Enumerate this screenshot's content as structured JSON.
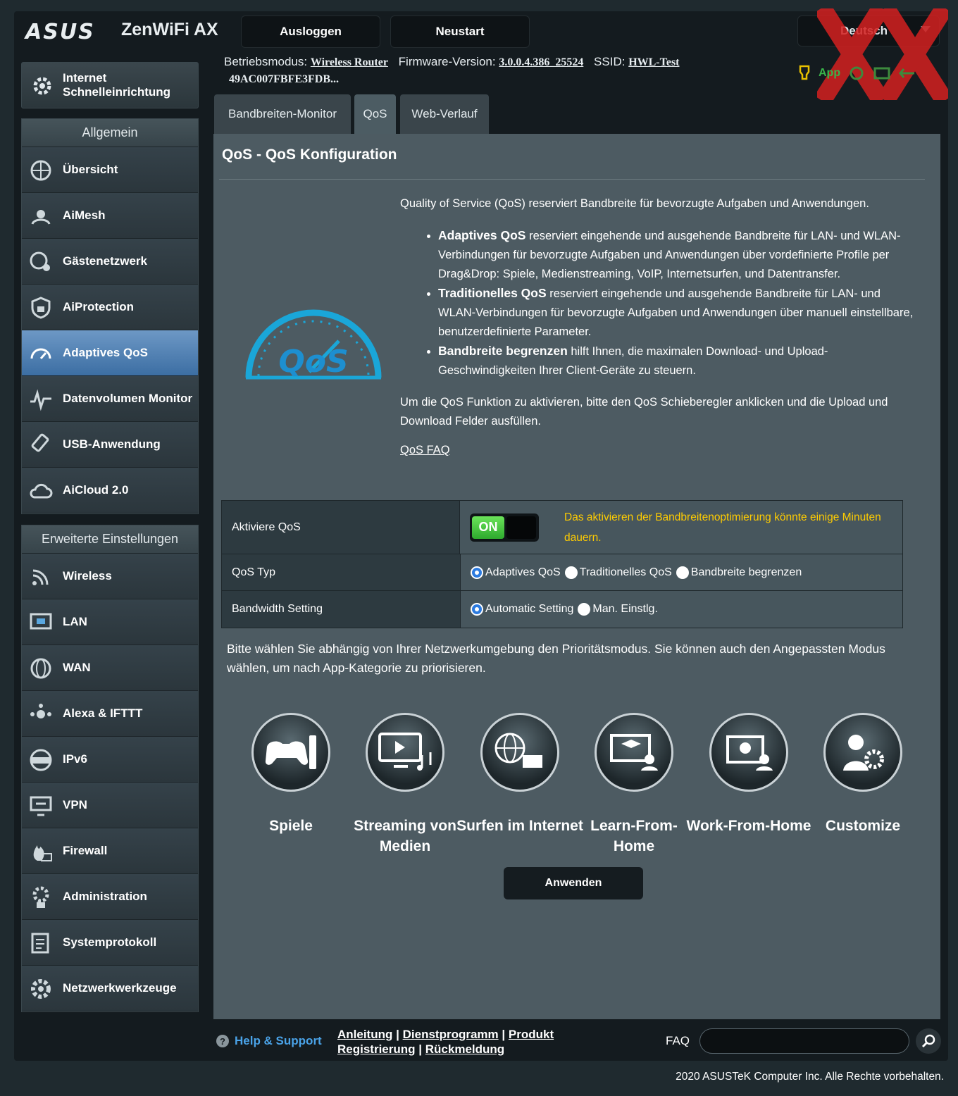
{
  "header": {
    "logo": "ASUS",
    "model": "ZenWiFi AX",
    "logout_label": "Ausloggen",
    "reboot_label": "Neustart",
    "language": "Deutsch"
  },
  "status": {
    "mode_label": "Betriebsmodus:",
    "mode_value": "Wireless Router",
    "fw_label": "Firmware-Version:",
    "fw_value": "3.0.0.4.386_25524",
    "ssid_label": "SSID:",
    "ssid_value": "HWL-Test",
    "ssid_value2": "49AC007FBFE3FDB...",
    "app_label": "App"
  },
  "sidebar": {
    "quick_setup": "Internet Schnelleinrichtung",
    "general_title": "Allgemein",
    "general_items": [
      {
        "label": "Übersicht",
        "icon": "globe-icon"
      },
      {
        "label": "AiMesh",
        "icon": "mesh-icon"
      },
      {
        "label": "Gästenetzwerk",
        "icon": "guest-network-icon"
      },
      {
        "label": "AiProtection",
        "icon": "shield-lock-icon"
      },
      {
        "label": "Adaptives QoS",
        "icon": "speedometer-icon"
      },
      {
        "label": "Datenvolumen Monitor",
        "icon": "traffic-monitor-icon"
      },
      {
        "label": "USB-Anwendung",
        "icon": "usb-icon"
      },
      {
        "label": "AiCloud 2.0",
        "icon": "cloud-icon"
      }
    ],
    "advanced_title": "Erweiterte Einstellungen",
    "advanced_items": [
      {
        "label": "Wireless",
        "icon": "wireless-icon"
      },
      {
        "label": "LAN",
        "icon": "lan-icon"
      },
      {
        "label": "WAN",
        "icon": "wan-globe-icon"
      },
      {
        "label": "Alexa & IFTTT",
        "icon": "alexa-icon"
      },
      {
        "label": "IPv6",
        "icon": "ipv6-icon"
      },
      {
        "label": "VPN",
        "icon": "vpn-icon"
      },
      {
        "label": "Firewall",
        "icon": "firewall-icon"
      },
      {
        "label": "Administration",
        "icon": "admin-gear-icon"
      },
      {
        "label": "Systemprotokoll",
        "icon": "log-icon"
      },
      {
        "label": "Netzwerkwerkzeuge",
        "icon": "network-tools-icon"
      }
    ]
  },
  "tabs": [
    {
      "label": "Bandbreiten-Monitor"
    },
    {
      "label": "QoS"
    },
    {
      "label": "Web-Verlauf"
    }
  ],
  "main": {
    "title": "QoS - QoS Konfiguration",
    "gauge_text": "QoS",
    "intro": "Quality of Service (QoS) reserviert Bandbreite für bevorzugte Aufgaben und Anwendungen.",
    "bullets": [
      {
        "bold": "Adaptives QoS",
        "text": " reserviert eingehende und ausgehende Bandbreite für LAN- und WLAN-Verbindungen für bevorzugte Aufgaben und Anwendungen über vordefinierte Profile per Drag&Drop: Spiele, Medienstreaming, VoIP, Internetsurfen, und Datentransfer."
      },
      {
        "bold": "Traditionelles QoS",
        "text": " reserviert eingehende und ausgehende Bandbreite für LAN- und WLAN-Verbindungen für bevorzugte Aufgaben und Anwendungen über manuell einstellbare, benutzerdefinierte Parameter."
      },
      {
        "bold": "Bandbreite begrenzen",
        "text": " hilft Ihnen, die maximalen Download- und Upload-Geschwindigkeiten Ihrer Client-Geräte zu steuern."
      }
    ],
    "activate_hint": "Um die QoS Funktion zu aktivieren, bitte den QoS Schieberegler anklicken und die Upload und Download Felder ausfüllen.",
    "faq_link": "QoS FAQ",
    "table": {
      "enable_label": "Aktiviere QoS",
      "toggle_state": "ON",
      "warning": "Das aktivieren der Bandbreitenoptimierung könnte einige Minuten dauern.",
      "type_label": "QoS Typ",
      "type_options": [
        "Adaptives QoS",
        "Traditionelles QoS",
        "Bandbreite begrenzen"
      ],
      "type_selected": "Adaptives QoS",
      "bw_label": "Bandwidth Setting",
      "bw_options": [
        "Automatic Setting",
        "Man. Einstlg."
      ],
      "bw_selected": "Automatic Setting"
    },
    "priority_text": "Bitte wählen Sie abhängig von Ihrer Netzwerkumgebung den Prioritätsmodus. Sie können auch den Angepassten Modus wählen, um nach App-Kategorie zu priorisieren.",
    "modes": [
      {
        "label": "Spiele",
        "icon": "gamepad-icon"
      },
      {
        "label": "Streaming von Medien",
        "icon": "media-streaming-icon"
      },
      {
        "label": "Surfen im Internet",
        "icon": "web-surfing-icon"
      },
      {
        "label": "Learn-From-Home",
        "icon": "learn-from-home-icon"
      },
      {
        "label": "Work-From-Home",
        "icon": "work-from-home-icon"
      },
      {
        "label": "Customize",
        "icon": "customize-icon"
      }
    ],
    "apply_label": "Anwenden"
  },
  "footer": {
    "help": "Help & Support",
    "link_manual": "Anleitung",
    "link_utility": "Dienstprogramm",
    "link_product": "Produkt",
    "link_registration": "Registrierung",
    "link_feedback": "Rückmeldung",
    "sep": "|",
    "faq_label": "FAQ",
    "faq_value": "",
    "copyright": "2020 ASUSTeK Computer Inc. Alle Rechte vorbehalten."
  },
  "colors": {
    "accent_green": "#39b54a",
    "warning_yellow": "#ffcc00",
    "active_blue": "#3c6ea3",
    "link_blue": "#4aa3e8"
  }
}
